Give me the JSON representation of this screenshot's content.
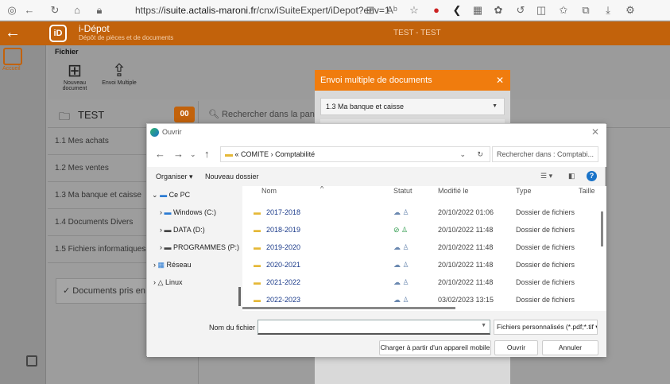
{
  "browser": {
    "url_prefix": "https://",
    "url_host": "isuite.actalis-maroni.fr",
    "url_path": "/cnx/iSuiteExpert/iDepot?env=1"
  },
  "app": {
    "logo": "iD",
    "title": "i-Dépot",
    "subtitle": "Dépôt de pièces et de documents",
    "env_label": "TEST - TEST",
    "home_label": "Accueil"
  },
  "toolbar": {
    "section": "Fichier",
    "new_doc": "Nouveau document",
    "multi_send": "Envoi Multiple"
  },
  "sidebar": {
    "test_label": "TEST",
    "badge": "00",
    "categories": [
      "1.1 Mes achats",
      "1.2 Mes ventes",
      "1.3 Ma banque et caisse",
      "1.4 Documents Divers",
      "1.5 Fichiers informatiques"
    ],
    "docs_pris": "✓ Documents pris en c"
  },
  "search": {
    "placeholder": "Rechercher dans la panière"
  },
  "envoi_modal": {
    "title": "Envoi multiple de documents",
    "select_value": "1.3 Ma banque et caisse"
  },
  "dialog": {
    "title": "Ouvrir",
    "path": [
      "«",
      "COMITE",
      "›",
      "Comptabilité"
    ],
    "search_placeholder": "Rechercher dans : Comptabi...",
    "organiser": "Organiser ▾",
    "nouveau_dossier": "Nouveau dossier",
    "nav": [
      {
        "label": "Ce PC",
        "icon": "pc-icon"
      },
      {
        "label": "Windows (C:)",
        "icon": "drive-icon"
      },
      {
        "label": "DATA (D:)",
        "icon": "drive-icon"
      },
      {
        "label": "PROGRAMMES (P:)",
        "icon": "drive-icon"
      },
      {
        "label": "Réseau",
        "icon": "network-icon"
      },
      {
        "label": "Linux",
        "icon": "linux-icon"
      }
    ],
    "columns": {
      "name": "Nom",
      "status": "Statut",
      "modified": "Modifié le",
      "type": "Type",
      "size": "Taille"
    },
    "files": [
      {
        "name": "2017-2018",
        "status": "☁ ♙",
        "date": "20/10/2022 01:06",
        "type": "Dossier de fichiers"
      },
      {
        "name": "2018-2019",
        "status": "⊘ ♙",
        "date": "20/10/2022 11:48",
        "type": "Dossier de fichiers"
      },
      {
        "name": "2019-2020",
        "status": "☁ ♙",
        "date": "20/10/2022 11:48",
        "type": "Dossier de fichiers"
      },
      {
        "name": "2020-2021",
        "status": "☁ ♙",
        "date": "20/10/2022 11:48",
        "type": "Dossier de fichiers"
      },
      {
        "name": "2021-2022",
        "status": "☁ ♙",
        "date": "20/10/2022 11:48",
        "type": "Dossier de fichiers"
      },
      {
        "name": "2022-2023",
        "status": "☁ ♙",
        "date": "03/02/2023 13:15",
        "type": "Dossier de fichiers"
      }
    ],
    "filename_label": "Nom du fichier :",
    "filename_value": "",
    "filter": "Fichiers personnalisés (*.pdf;*.tif ▾",
    "btn_mobile": "Charger à partir d'un appareil mobile",
    "btn_open": "Ouvrir",
    "btn_cancel": "Annuler"
  }
}
